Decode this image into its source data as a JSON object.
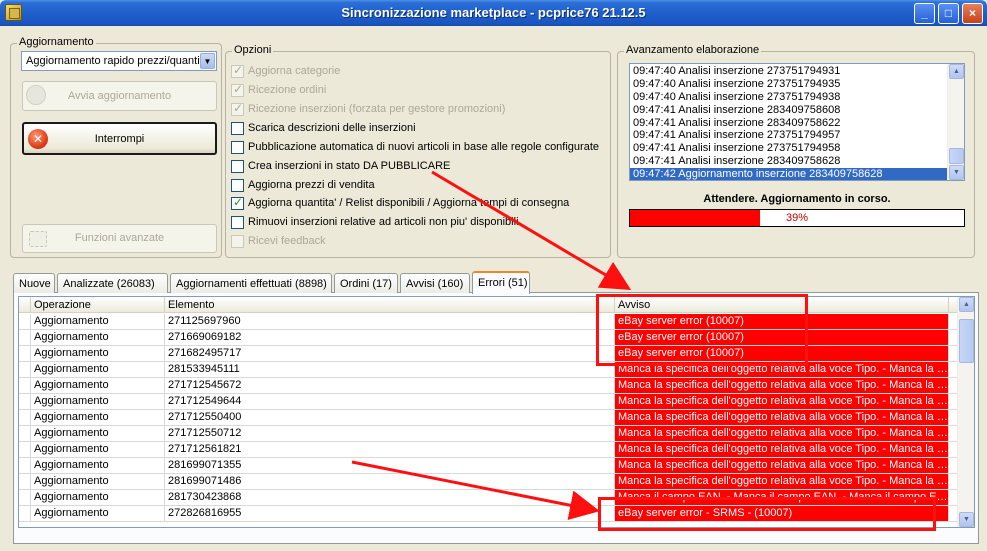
{
  "window": {
    "title": "Sincronizzazione marketplace - pcprice76 21.12.5",
    "minimize_glyph": "_",
    "maximize_glyph": "□",
    "close_glyph": "×"
  },
  "update_group": {
    "title": "Aggiornamento",
    "mode_value": "Aggiornamento rapido prezzi/quantit",
    "start_button": "Avvia aggiornamento",
    "stop_button": "Interrompi",
    "advanced_button": "Funzioni avanzate"
  },
  "options_group": {
    "title": "Opzioni",
    "items": [
      {
        "label": "Aggiorna categorie",
        "checked": true,
        "enabled": false
      },
      {
        "label": "Ricezione ordini",
        "checked": true,
        "enabled": false
      },
      {
        "label": "Ricezione inserzioni (forzata per gestore promozioni)",
        "checked": true,
        "enabled": false
      },
      {
        "label": "Scarica descrizioni delle inserzioni",
        "checked": false,
        "enabled": true
      },
      {
        "label": "Pubblicazione automatica di nuovi articoli in base alle regole configurate",
        "checked": false,
        "enabled": true
      },
      {
        "label": "Crea inserzioni in stato DA PUBBLICARE",
        "checked": false,
        "enabled": true
      },
      {
        "label": "Aggiorna prezzi di vendita",
        "checked": false,
        "enabled": true
      },
      {
        "label": "Aggiorna quantita' / Relist disponibili / Aggiorna tempi di consegna",
        "checked": true,
        "enabled": true
      },
      {
        "label": "Rimuovi inserzioni relative ad articoli non piu' disponibili",
        "checked": false,
        "enabled": true
      },
      {
        "label": "Ricevi feedback",
        "checked": false,
        "enabled": false
      }
    ]
  },
  "progress_group": {
    "title": "Avanzamento elaborazione",
    "log": [
      "09:47:40 Analisi inserzione 273751794931",
      "09:47:40 Analisi inserzione 273751794935",
      "09:47:40 Analisi inserzione 273751794938",
      "09:47:41 Analisi inserzione 283409758608",
      "09:47:41 Analisi inserzione 283409758622",
      "09:47:41 Analisi inserzione 273751794957",
      "09:47:41 Analisi inserzione 273751794958",
      "09:47:41 Analisi inserzione 283409758628",
      "09:47:42 Aggiornamento inserzione 283409758628"
    ],
    "selected_index": 8,
    "status": "Attendere. Aggiornamento in corso.",
    "percent": 39,
    "percent_label": "39%"
  },
  "tabs": [
    {
      "label": "Nuove",
      "active": false
    },
    {
      "label": "Analizzate (26083)",
      "active": false
    },
    {
      "label": "Aggiornamenti effettuati (8898)",
      "active": false
    },
    {
      "label": "Ordini (17)",
      "active": false
    },
    {
      "label": "Avvisi (160)",
      "active": false
    },
    {
      "label": "Errori (51)",
      "active": true
    }
  ],
  "errors_table": {
    "columns": [
      "Operazione",
      "Elemento",
      "Avviso"
    ],
    "rows": [
      {
        "op": "Aggiornamento",
        "el": "271125697960",
        "msg": "eBay server error (10007)"
      },
      {
        "op": "Aggiornamento",
        "el": "271669069182",
        "msg": "eBay server error (10007)"
      },
      {
        "op": "Aggiornamento",
        "el": "271682495717",
        "msg": "eBay server error (10007)"
      },
      {
        "op": "Aggiornamento",
        "el": "281533945111",
        "msg": "Manca la specifica dell'oggetto relativa alla voce Tipo. - Manca la specifica dell'oggetto relativa alla voce Tipo."
      },
      {
        "op": "Aggiornamento",
        "el": "271712545672",
        "msg": "Manca la specifica dell'oggetto relativa alla voce Tipo. - Manca la specifica dell'oggetto relativa alla voce Tipo."
      },
      {
        "op": "Aggiornamento",
        "el": "271712549644",
        "msg": "Manca la specifica dell'oggetto relativa alla voce Tipo. - Manca la specifica dell'oggetto relativa alla voce Tipo."
      },
      {
        "op": "Aggiornamento",
        "el": "271712550400",
        "msg": "Manca la specifica dell'oggetto relativa alla voce Tipo. - Manca la specifica dell'oggetto relativa alla voce Tipo."
      },
      {
        "op": "Aggiornamento",
        "el": "271712550712",
        "msg": "Manca la specifica dell'oggetto relativa alla voce Tipo. - Manca la specifica dell'oggetto relativa alla voce Tipo."
      },
      {
        "op": "Aggiornamento",
        "el": "271712561821",
        "msg": "Manca la specifica dell'oggetto relativa alla voce Tipo. - Manca la specifica dell'oggetto relativa alla voce Tipo."
      },
      {
        "op": "Aggiornamento",
        "el": "281699071355",
        "msg": "Manca la specifica dell'oggetto relativa alla voce Tipo. - Manca la specifica dell'oggetto relativa alla voce Tipo."
      },
      {
        "op": "Aggiornamento",
        "el": "281699071486",
        "msg": "Manca la specifica dell'oggetto relativa alla voce Tipo. - Manca la specifica dell'oggetto relativa alla voce Tipo."
      },
      {
        "op": "Aggiornamento",
        "el": "281730423868",
        "msg": "Manca il campo EAN. - Manca il campo EAN. - Manca il campo EAN."
      },
      {
        "op": "Aggiornamento",
        "el": "272826816955",
        "msg": "eBay server error - SRMS -  (10007)"
      }
    ]
  },
  "accent_colors": {
    "error_row": "#ff0000",
    "annotation": "#ff1010",
    "selection": "#316ac5"
  }
}
